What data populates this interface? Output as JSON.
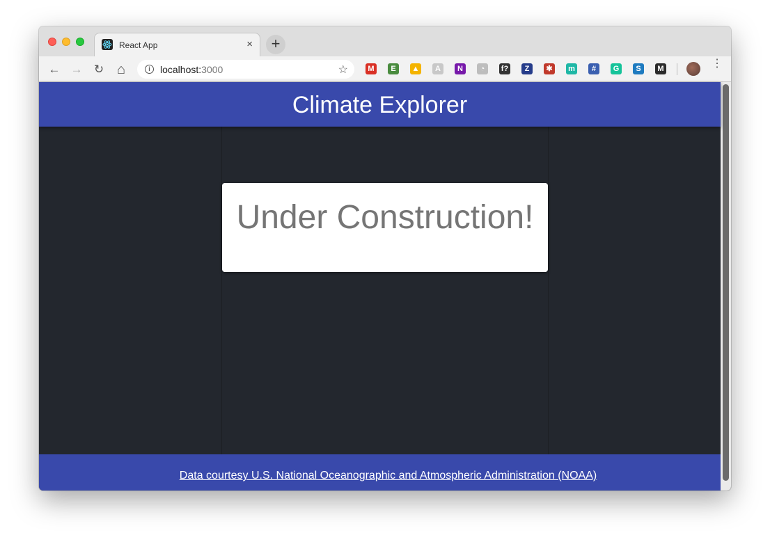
{
  "browser": {
    "tab_title": "React App",
    "tab_close": "×",
    "new_tab": "+",
    "url_host": "localhost:",
    "url_port": "3000",
    "nav": {
      "back": "←",
      "forward": "→",
      "reload": "↻",
      "home": "⌂"
    },
    "star": "☆",
    "menu": "⋮",
    "extensions": [
      {
        "name": "gmail-icon",
        "label": "M",
        "color": "#d93025"
      },
      {
        "name": "evernote-clip-icon",
        "label": "E",
        "color": "#4a8c3f"
      },
      {
        "name": "google-drive-icon",
        "label": "▲",
        "color": "#f4b400"
      },
      {
        "name": "docs-icon",
        "label": "A",
        "color": "#c8c8c8"
      },
      {
        "name": "onenote-icon",
        "label": "N",
        "color": "#7719aa"
      },
      {
        "name": "timer-icon",
        "label": "◔",
        "color": "#bdbdbd"
      },
      {
        "name": "whatfont-icon",
        "label": "f?",
        "color": "#333333"
      },
      {
        "name": "zotero-icon",
        "label": "Z",
        "color": "#253c8a"
      },
      {
        "name": "bug-icon",
        "label": "✱",
        "color": "#c0392b"
      },
      {
        "name": "mercury-icon",
        "label": "m",
        "color": "#1fb7a6"
      },
      {
        "name": "hashtag-icon",
        "label": "#",
        "color": "#3a5fb0"
      },
      {
        "name": "grammarly-icon",
        "label": "G",
        "color": "#15c39a"
      },
      {
        "name": "scribd-icon",
        "label": "S",
        "color": "#1e7bc0"
      },
      {
        "name": "mendeley-icon",
        "label": "M",
        "color": "#2b2b2b"
      }
    ]
  },
  "app": {
    "title": "Climate Explorer",
    "card_text": "Under Construction!",
    "footer_link": "Data courtesy U.S. National Oceanographic and Atmospheric Administration (NOAA)"
  }
}
